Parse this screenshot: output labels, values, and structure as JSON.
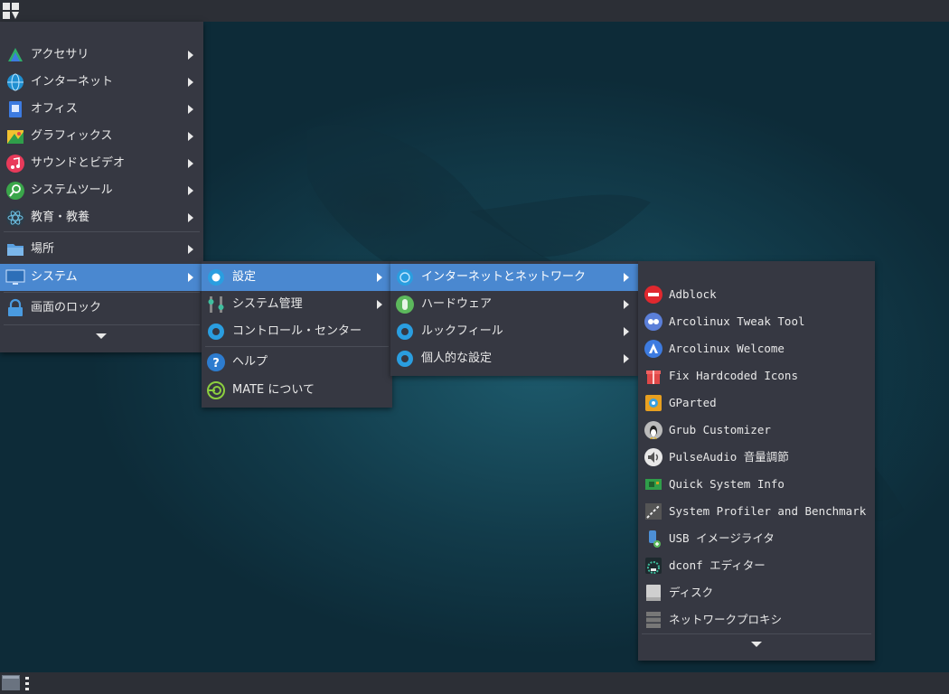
{
  "main_menu": {
    "items": [
      {
        "label": "アクセサリ"
      },
      {
        "label": "インターネット"
      },
      {
        "label": "オフィス"
      },
      {
        "label": "グラフィックス"
      },
      {
        "label": "サウンドとビデオ"
      },
      {
        "label": "システムツール"
      },
      {
        "label": "教育・教養"
      },
      {
        "label": "場所"
      },
      {
        "label": "システム"
      },
      {
        "label": "画面のロック"
      }
    ]
  },
  "system_menu": {
    "items": [
      {
        "label": "設定"
      },
      {
        "label": "システム管理"
      },
      {
        "label": "コントロール・センター"
      },
      {
        "label": "ヘルプ"
      },
      {
        "label": "MATE について"
      }
    ]
  },
  "settings_menu": {
    "items": [
      {
        "label": "インターネットとネットワーク"
      },
      {
        "label": "ハードウェア"
      },
      {
        "label": "ルックフィール"
      },
      {
        "label": "個人的な設定"
      }
    ]
  },
  "network_menu": {
    "items": [
      {
        "label": "Adblock",
        "icon": "no-entry-icon",
        "color": "#e0282e"
      },
      {
        "label": "Arcolinux Tweak Tool",
        "icon": "tweak-tool-icon",
        "color": "#5b7fd9"
      },
      {
        "label": "Arcolinux Welcome",
        "icon": "arcolinux-icon",
        "color": "#3d7be0"
      },
      {
        "label": "Fix Hardcoded Icons",
        "icon": "gift-icon",
        "color": "#e04848"
      },
      {
        "label": "GParted",
        "icon": "gparted-icon",
        "color": "#e8a020"
      },
      {
        "label": "Grub Customizer",
        "icon": "tux-gear-icon",
        "color": "#bbbbbb"
      },
      {
        "label": "PulseAudio 音量調節",
        "icon": "speaker-icon",
        "color": "#e8e8e8"
      },
      {
        "label": "Quick System Info",
        "icon": "circuit-board-icon",
        "color": "#2f9e4a"
      },
      {
        "label": "System Profiler and Benchmark",
        "icon": "profiler-icon",
        "color": "#555555"
      },
      {
        "label": "USB イメージライタ",
        "icon": "usb-writer-icon",
        "color": "#4d8fd6"
      },
      {
        "label": "dconf エディター",
        "icon": "dconf-icon",
        "color": "#2a6b5e"
      },
      {
        "label": "ディスク",
        "icon": "disk-icon",
        "color": "#cfcfcf"
      },
      {
        "label": "ネットワークプロキシ",
        "icon": "proxy-icon",
        "color": "#777777"
      }
    ]
  }
}
